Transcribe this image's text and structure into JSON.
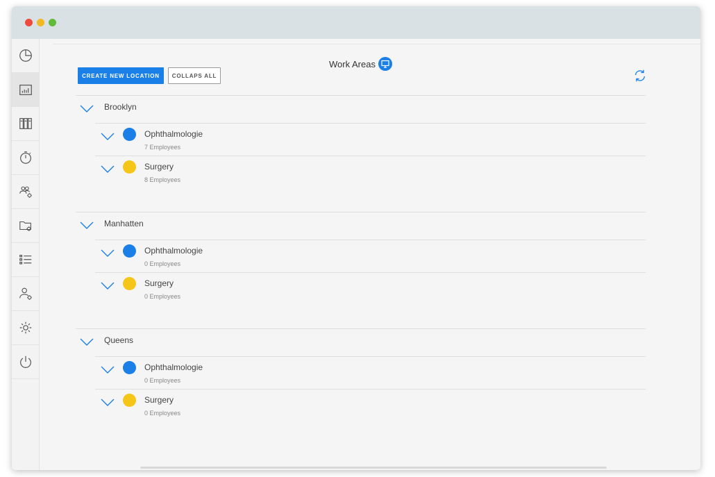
{
  "window": {
    "controls": [
      "close",
      "minimize",
      "maximize"
    ],
    "colors": {
      "close": "#ee4b3e",
      "minimize": "#f2b824",
      "maximize": "#60bb38"
    }
  },
  "sidebar": {
    "items": [
      {
        "icon": "pie-chart-icon",
        "active": false
      },
      {
        "icon": "bar-chart-icon",
        "active": true
      },
      {
        "icon": "binders-icon",
        "active": false
      },
      {
        "icon": "stopwatch-icon",
        "active": false
      },
      {
        "icon": "team-settings-icon",
        "active": false
      },
      {
        "icon": "folder-settings-icon",
        "active": false
      },
      {
        "icon": "list-icon",
        "active": false
      },
      {
        "icon": "user-settings-icon",
        "active": false
      },
      {
        "icon": "gear-icon",
        "active": false
      },
      {
        "icon": "power-icon",
        "active": false
      }
    ]
  },
  "header": {
    "title": "Work Areas",
    "title_icon": "monitor-icon",
    "create_label": "CREATE NEW LOCATION",
    "collapse_label": "COLLAPS ALL",
    "refresh_icon": "refresh-icon"
  },
  "colors": {
    "accent": "#1a7fe6",
    "blue_dot": "#1a7fe6",
    "yellow_dot": "#f5c518"
  },
  "locations": [
    {
      "name": "Brooklyn",
      "areas": [
        {
          "name": "Ophthalmologie",
          "count": "7 Employees",
          "color": "#1a7fe6"
        },
        {
          "name": "Surgery",
          "count": "8 Employees",
          "color": "#f5c518"
        }
      ]
    },
    {
      "name": "Manhatten",
      "areas": [
        {
          "name": "Ophthalmologie",
          "count": "0 Employees",
          "color": "#1a7fe6"
        },
        {
          "name": "Surgery",
          "count": "0 Employees",
          "color": "#f5c518"
        }
      ]
    },
    {
      "name": "Queens",
      "areas": [
        {
          "name": "Ophthalmologie",
          "count": "0 Employees",
          "color": "#1a7fe6"
        },
        {
          "name": "Surgery",
          "count": "0 Employees",
          "color": "#f5c518"
        }
      ]
    }
  ]
}
